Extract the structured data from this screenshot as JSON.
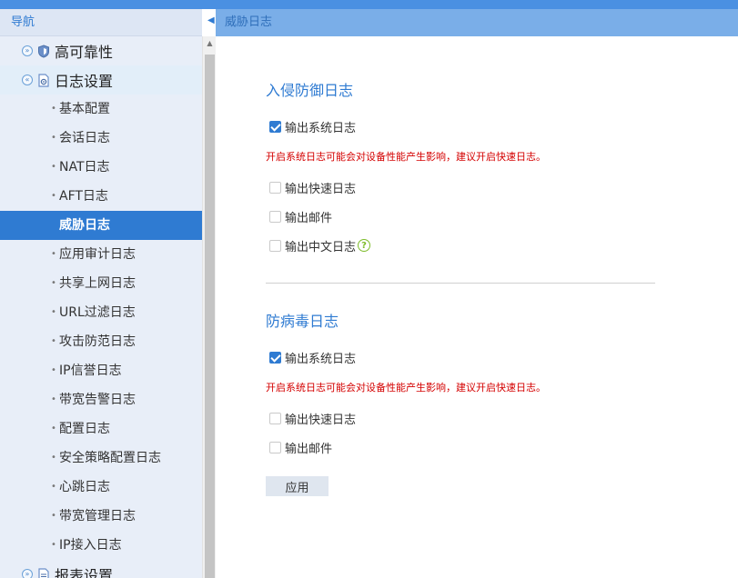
{
  "nav": {
    "header": "导航",
    "groups": [
      {
        "label": "高可靠性",
        "state": "collapsed"
      },
      {
        "label": "日志设置",
        "state": "expanded"
      },
      {
        "label": "报表设置",
        "state": "collapsed"
      }
    ],
    "items": [
      "基本配置",
      "会话日志",
      "NAT日志",
      "AFT日志",
      "威胁日志",
      "应用审计日志",
      "共享上网日志",
      "URL过滤日志",
      "攻击防范日志",
      "IP信誉日志",
      "带宽告警日志",
      "配置日志",
      "安全策略配置日志",
      "心跳日志",
      "带宽管理日志",
      "IP接入日志"
    ],
    "active_item": "威胁日志"
  },
  "content": {
    "header": "威胁日志",
    "ips": {
      "title": "入侵防御日志",
      "output_syslog": {
        "label": "输出系统日志",
        "checked": true
      },
      "warning": "开启系统日志可能会对设备性能产生影响，建议开启快速日志。",
      "output_fastlog": {
        "label": "输出快速日志",
        "checked": false
      },
      "output_mail": {
        "label": "输出邮件",
        "checked": false
      },
      "output_chinese": {
        "label": "输出中文日志",
        "checked": false
      }
    },
    "av": {
      "title": "防病毒日志",
      "output_syslog": {
        "label": "输出系统日志",
        "checked": true
      },
      "warning": "开启系统日志可能会对设备性能产生影响，建议开启快速日志。",
      "output_fastlog": {
        "label": "输出快速日志",
        "checked": false
      },
      "output_mail": {
        "label": "输出邮件",
        "checked": false
      }
    },
    "apply_label": "应用"
  },
  "colors": {
    "accent": "#2f7bd2",
    "warning": "#d40000",
    "help": "#7dbb2a"
  }
}
